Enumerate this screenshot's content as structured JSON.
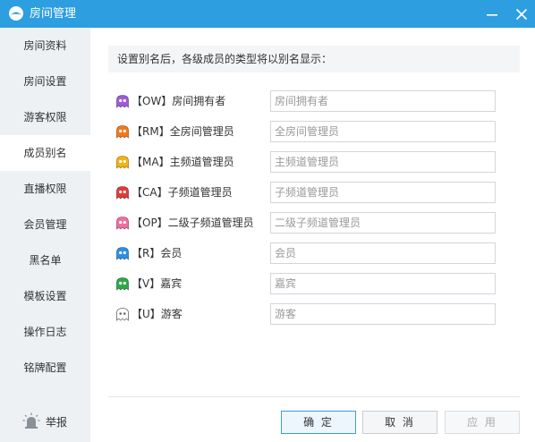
{
  "window": {
    "title": "房间管理"
  },
  "sidebar": {
    "items": [
      {
        "label": "房间资料",
        "active": false
      },
      {
        "label": "房间设置",
        "active": false
      },
      {
        "label": "游客权限",
        "active": false
      },
      {
        "label": "成员别名",
        "active": true
      },
      {
        "label": "直播权限",
        "active": false
      },
      {
        "label": "会员管理",
        "active": false
      },
      {
        "label": "黑名单",
        "active": false
      },
      {
        "label": "模板设置",
        "active": false
      },
      {
        "label": "操作日志",
        "active": false
      },
      {
        "label": "铭牌配置",
        "active": false
      }
    ],
    "report_label": "举报"
  },
  "main": {
    "info": "设置别名后，各级成员的类型将以别名显示：",
    "roles": [
      {
        "label": "【OW】房间拥有者",
        "placeholder": "房间拥有者",
        "icon": "purple-ghost-icon",
        "color": "#a05ad6"
      },
      {
        "label": "【RM】全房间管理员",
        "placeholder": "全房间管理员",
        "icon": "orange-ghost-icon",
        "color": "#f07a1e"
      },
      {
        "label": "【MA】主频道管理员",
        "placeholder": "主频道管理员",
        "icon": "yellow-ghost-icon",
        "color": "#f5b312"
      },
      {
        "label": "【CA】子频道管理员",
        "placeholder": "子频道管理员",
        "icon": "red-ghost-icon",
        "color": "#e23a3a"
      },
      {
        "label": "【OP】二级子频道管理员",
        "placeholder": "二级子频道管理员",
        "icon": "pink-ghost-icon",
        "color": "#ef6fa0"
      },
      {
        "label": "【R】会员",
        "placeholder": "会员",
        "icon": "blue-ghost-icon",
        "color": "#2f8fe0"
      },
      {
        "label": "【V】嘉宾",
        "placeholder": "嘉宾",
        "icon": "green-ghost-icon",
        "color": "#2ea84a"
      },
      {
        "label": "【U】游客",
        "placeholder": "游客",
        "icon": "white-ghost-icon",
        "color": "#ffffff"
      }
    ]
  },
  "footer": {
    "ok_label": "确 定",
    "cancel_label": "取 消",
    "apply_label": "应 用"
  },
  "colors": {
    "titlebar": "#2d9ee0",
    "sidebar": "#eef1f4"
  }
}
